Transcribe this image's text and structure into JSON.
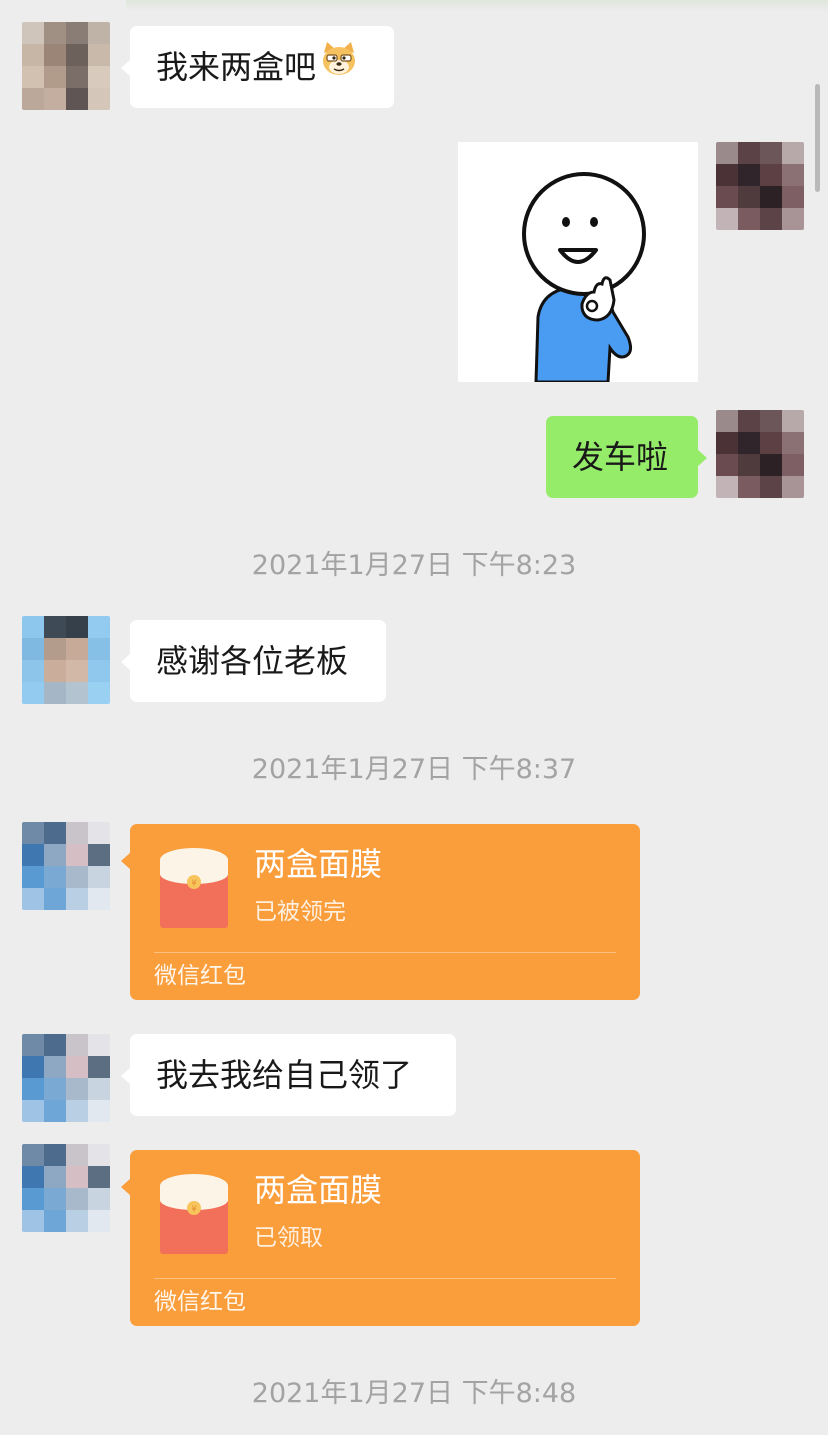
{
  "messages": {
    "m1": {
      "text": "我来两盒吧"
    },
    "m3": {
      "text": "发车啦"
    },
    "m4": {
      "text": "感谢各位老板"
    },
    "m5": {
      "title": "两盒面膜",
      "status": "已被领完",
      "footer": "微信红包"
    },
    "m6": {
      "text": "我去我给自己领了"
    },
    "m7": {
      "title": "两盒面膜",
      "status": "已领取",
      "footer": "微信红包"
    }
  },
  "timestamps": {
    "t1": "2021年1月27日 下午8:23",
    "t2": "2021年1月27日 下午8:37",
    "t3": "2021年1月27日 下午8:48"
  },
  "icons": {
    "m1_emoji": "doge-emoji",
    "sticker": "ok-hand-stickman-sticker",
    "red_packet": "red-packet-icon"
  },
  "colors": {
    "background": "#ededed",
    "incoming_bubble": "#ffffff",
    "outgoing_bubble": "#95ec69",
    "red_packet": "#fa9d3b",
    "timestamp_text": "#a3a3a3"
  }
}
